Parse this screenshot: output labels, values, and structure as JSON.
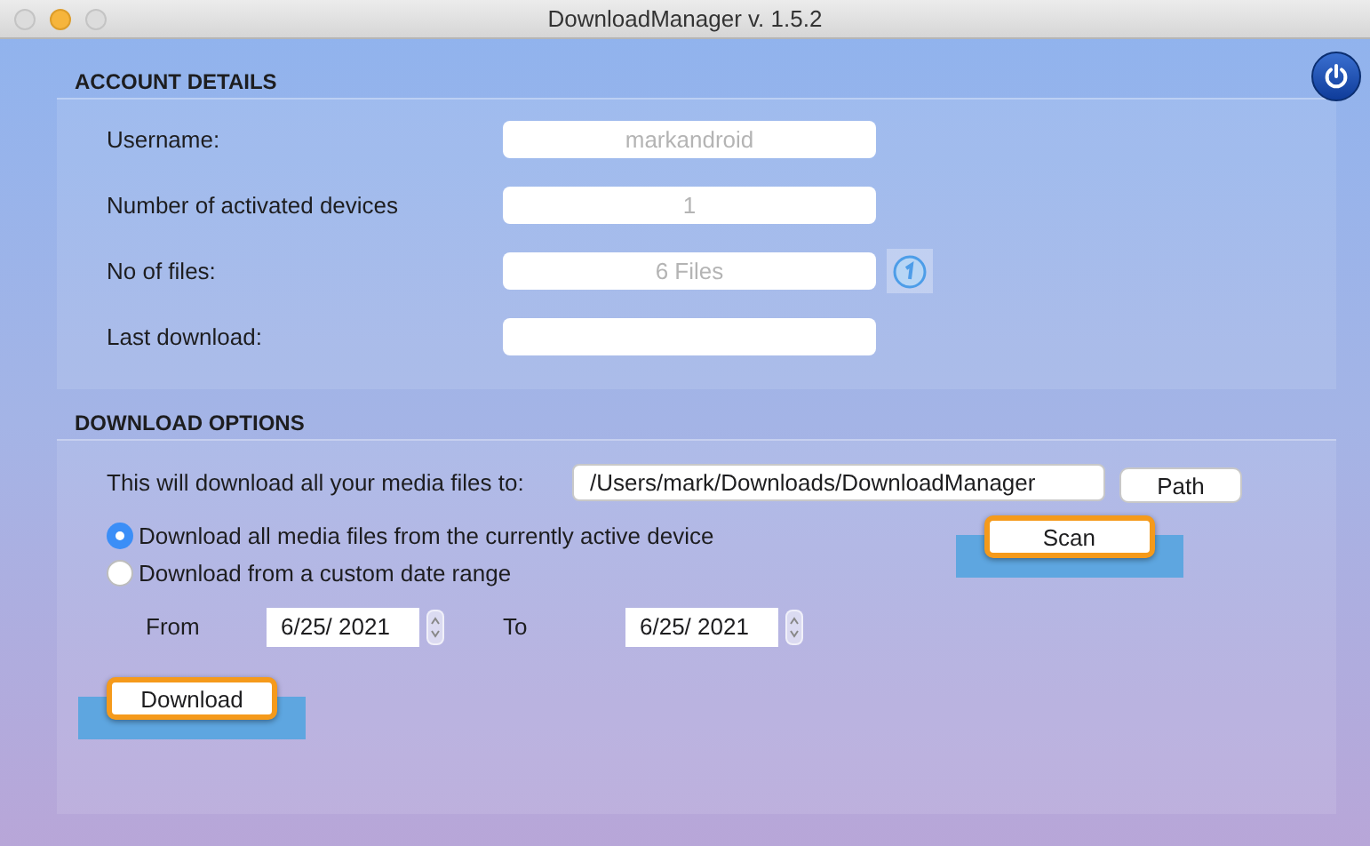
{
  "window": {
    "title": "DownloadManager v. 1.5.2"
  },
  "account_details": {
    "heading": "ACCOUNT DETAILS",
    "rows": [
      {
        "label": "Username:",
        "value": "markandroid"
      },
      {
        "label": "Number of activated devices",
        "value": "1"
      },
      {
        "label": "No of files:",
        "value": "6 Files",
        "info_button": true
      },
      {
        "label": "Last download:"
      }
    ]
  },
  "download_options": {
    "heading": "DOWNLOAD OPTIONS",
    "path_label": "This will download all your media files to:",
    "path_value": "/Users/mark/Downloads/DownloadManager",
    "path_button": {
      "label": "Path",
      "highlighted": false
    },
    "radios": [
      {
        "label": "Download all media files from the currently active device",
        "selected": true
      },
      {
        "label": "Download from a custom date range",
        "selected": false
      }
    ],
    "scan_button": {
      "label": "Scan",
      "highlighted": true
    },
    "from_label": "From",
    "from_value": "6/25/ 2021",
    "to_label": "To",
    "to_value": "6/25/ 2021",
    "download_button": {
      "label": "Download",
      "highlighted": true
    }
  }
}
